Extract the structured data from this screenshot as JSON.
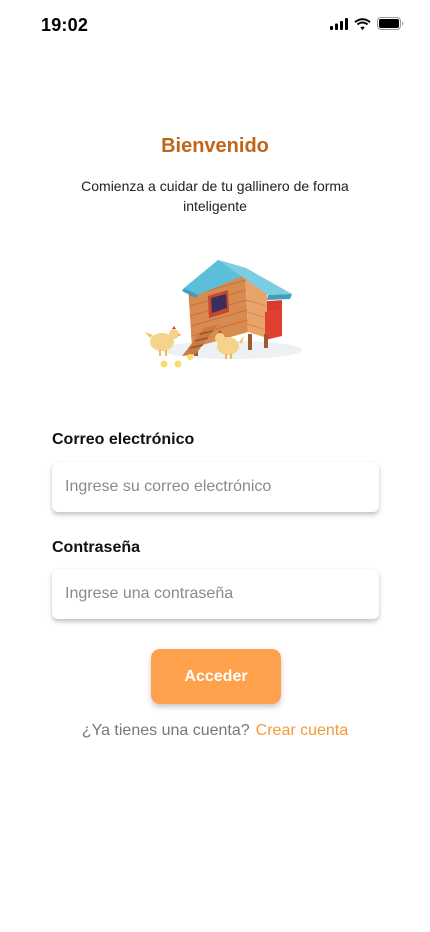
{
  "status_bar": {
    "time": "19:02",
    "icons": [
      "cellular-signal-icon",
      "wifi-icon",
      "battery-icon"
    ]
  },
  "header": {
    "title": "Bienvenido",
    "subtitle": "Comienza a cuidar de tu gallinero de forma inteligente"
  },
  "illustration": {
    "icon": "chicken-coop-illustration"
  },
  "form": {
    "email_label": "Correo electrónico",
    "email_placeholder": "Ingrese su correo electrónico",
    "email_value": "",
    "password_label": "Contraseña",
    "password_placeholder": "Ingrese una contraseña",
    "password_value": "",
    "submit_label": "Acceder"
  },
  "footer": {
    "question": "¿Ya tienes una cuenta?",
    "link": "Crear cuenta"
  },
  "colors": {
    "title": "#C0661A",
    "button": "#FFA04D",
    "link": "#F39A3A"
  }
}
